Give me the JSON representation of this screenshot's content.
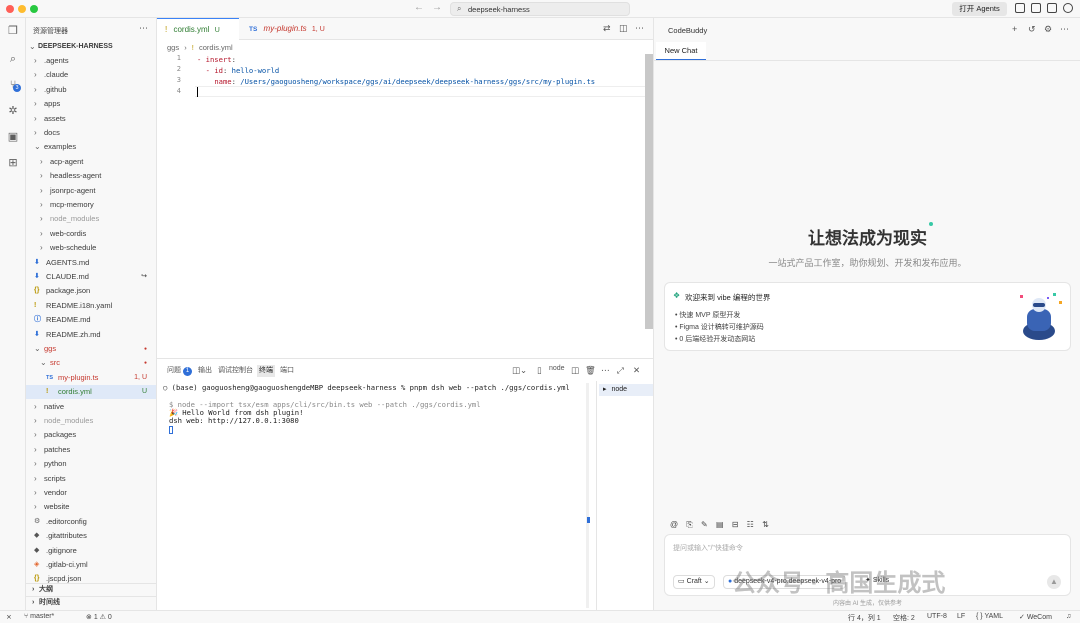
{
  "titlebar": {
    "search_text": "deepseek-harness",
    "open_agents": "打开 Agents"
  },
  "activity": {
    "scm_badge": "3"
  },
  "explorer": {
    "title": "资源管理器",
    "root": "DEEPSEEK-HARNESS",
    "items": [
      {
        "label": ".agents",
        "kind": "folder",
        "depth": 1
      },
      {
        "label": ".claude",
        "kind": "folder",
        "depth": 1
      },
      {
        "label": ".github",
        "kind": "folder",
        "depth": 1
      },
      {
        "label": "apps",
        "kind": "folder",
        "depth": 1
      },
      {
        "label": "assets",
        "kind": "folder",
        "depth": 1
      },
      {
        "label": "docs",
        "kind": "folder",
        "depth": 1
      },
      {
        "label": "examples",
        "kind": "folder-open",
        "depth": 1
      },
      {
        "label": "acp-agent",
        "kind": "folder",
        "depth": 2
      },
      {
        "label": "headless-agent",
        "kind": "folder",
        "depth": 2
      },
      {
        "label": "jsonrpc-agent",
        "kind": "folder",
        "depth": 2
      },
      {
        "label": "mcp-memory",
        "kind": "folder",
        "depth": 2
      },
      {
        "label": "node_modules",
        "kind": "folder",
        "depth": 2,
        "dim": true
      },
      {
        "label": "web-cordis",
        "kind": "folder",
        "depth": 2
      },
      {
        "label": "web-schedule",
        "kind": "folder",
        "depth": 2
      },
      {
        "label": "AGENTS.md",
        "kind": "md",
        "depth": 1
      },
      {
        "label": "CLAUDE.md",
        "kind": "md",
        "depth": 1,
        "deco": "↪"
      },
      {
        "label": "package.json",
        "kind": "json",
        "depth": 1
      },
      {
        "label": "README.i18n.yaml",
        "kind": "yaml",
        "depth": 1
      },
      {
        "label": "README.md",
        "kind": "info",
        "depth": 1
      },
      {
        "label": "README.zh.md",
        "kind": "md",
        "depth": 1
      },
      {
        "label": "ggs",
        "kind": "folder-open",
        "depth": 1,
        "red": true,
        "deco": "●"
      },
      {
        "label": "src",
        "kind": "folder-open",
        "depth": 2,
        "red": true,
        "deco": "●"
      },
      {
        "label": "my-plugin.ts",
        "kind": "ts",
        "depth": 3,
        "red": true,
        "deco": "1, U"
      },
      {
        "label": "cordis.yml",
        "kind": "yaml",
        "depth": 3,
        "green": true,
        "deco": "U",
        "selected": true
      },
      {
        "label": "native",
        "kind": "folder",
        "depth": 1
      },
      {
        "label": "node_modules",
        "kind": "folder",
        "depth": 1,
        "dim": true
      },
      {
        "label": "packages",
        "kind": "folder",
        "depth": 1
      },
      {
        "label": "patches",
        "kind": "folder",
        "depth": 1
      },
      {
        "label": "python",
        "kind": "folder",
        "depth": 1
      },
      {
        "label": "scripts",
        "kind": "folder",
        "depth": 1
      },
      {
        "label": "vendor",
        "kind": "folder",
        "depth": 1
      },
      {
        "label": "website",
        "kind": "folder",
        "depth": 1
      },
      {
        "label": ".editorconfig",
        "kind": "gear",
        "depth": 1
      },
      {
        "label": ".gitattributes",
        "kind": "git",
        "depth": 1
      },
      {
        "label": ".gitignore",
        "kind": "git",
        "depth": 1
      },
      {
        "label": ".gitlab-ci.yml",
        "kind": "gitlab",
        "depth": 1
      },
      {
        "label": ".jscpd.json",
        "kind": "json",
        "depth": 1
      }
    ],
    "outline": "大纲",
    "timeline": "时间线"
  },
  "editor": {
    "tabs": [
      {
        "name": "cordis.yml",
        "status": "U",
        "icon": "!"
      },
      {
        "name": "my-plugin.ts",
        "status": "1, U",
        "icon": "TS"
      }
    ],
    "breadcrumb_root": "ggs",
    "breadcrumb_file": "cordis.yml",
    "lines": [
      {
        "n": "1",
        "a": "- ",
        "b": "insert",
        "c": ":",
        "d": ""
      },
      {
        "n": "2",
        "a": "  - ",
        "b": "id",
        "c": ": ",
        "d": "hello-world"
      },
      {
        "n": "3",
        "a": "    ",
        "b": "name",
        "c": ": ",
        "d": "/Users/gaoguosheng/workspace/ggs/ai/deepseek/deepseek-harness/ggs/src/my-plugin.ts"
      },
      {
        "n": "4",
        "a": "",
        "b": "",
        "c": "",
        "d": ""
      }
    ]
  },
  "panel": {
    "tabs": {
      "problems": "问题",
      "problems_count": "1",
      "output": "输出",
      "debug": "调试控制台",
      "terminal": "终端",
      "ports": "端口"
    },
    "shell_label": "node",
    "terminal_lines": [
      "○ (base) gaoguosheng@gaoguoshengdeMBP deepseek-harness % pnpm dsh web --patch ./ggs/cordis.yml",
      "",
      "$ node --import tsx/esm apps/cli/src/bin.ts web --patch ./ggs/cordis.yml",
      "🎉 Hello World from dsh plugin!",
      "dsh web: http://127.0.0.1:3080"
    ],
    "term_list_item": "node"
  },
  "codebuddy": {
    "title": "CodeBuddy",
    "tab": "New Chat",
    "hero_title": "让想法成为现实",
    "hero_sub": "一站式产品工作室，助你规划、开发和发布应用。",
    "welcome_title": "欢迎来到 vibe 编程的世界",
    "welcome_items": [
      "快速 MVP 原型开发",
      "Figma 设计稿转可维护源码",
      "0 后端经验开发动态网站"
    ],
    "input_placeholder": "提问或输入\"/\"快捷命令",
    "chip_mode": "Craft",
    "chip_model": "deepseek-v4-pro.deepseek-v4-pro",
    "chip_skills": "Skills",
    "ai_note": "内容由 AI 生成，仅供参考"
  },
  "watermark": "公众号 · 高国生成式",
  "status": {
    "branch": "master*",
    "errors": "1",
    "warnings": "0",
    "cursor": "行 4，列 1",
    "spaces": "空格: 2",
    "encoding": "UTF-8",
    "eol": "LF",
    "language": "YAML",
    "wecom": "WeCom"
  },
  "colors": {
    "accent": "#2f6fd8",
    "modified": "#c5362c",
    "untracked": "#2f7d32"
  }
}
